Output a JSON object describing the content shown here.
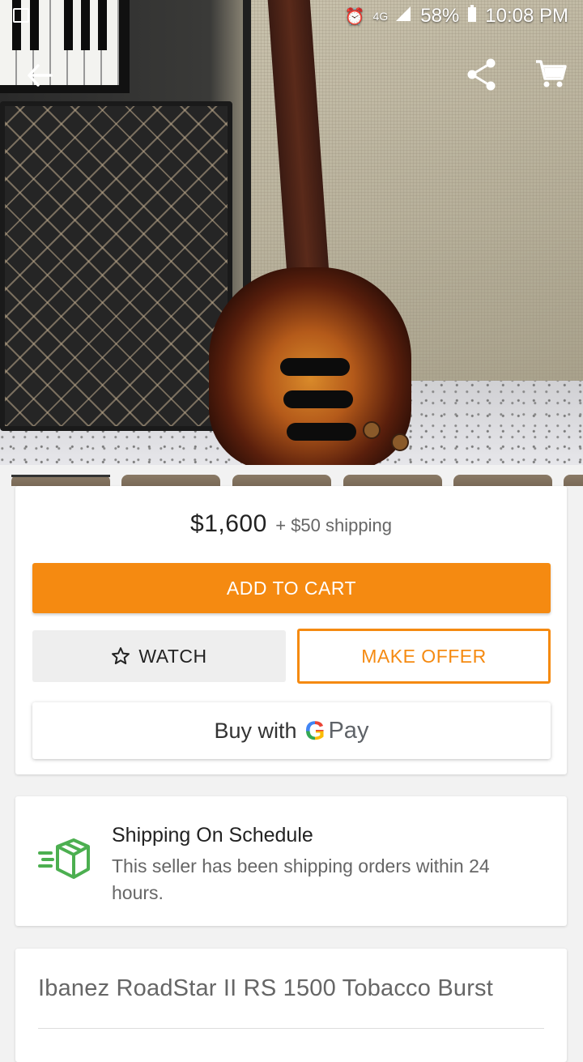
{
  "status_bar": {
    "battery": "58%",
    "time": "10:08 PM",
    "network": "4G"
  },
  "toolbar": {
    "back_icon": "arrow-left-icon",
    "share_icon": "share-icon",
    "cart_icon": "cart-icon"
  },
  "purchase": {
    "price": "$1,600",
    "shipping": "+ $50 shipping",
    "add_to_cart": "ADD TO CART",
    "watch": "WATCH",
    "make_offer": "MAKE OFFER",
    "buy_with": "Buy with",
    "gpay_g": "G",
    "gpay_pay": "Pay"
  },
  "shipping_info": {
    "title": "Shipping On Schedule",
    "text": "This seller has been shipping orders within 24 hours."
  },
  "listing": {
    "title": "Ibanez RoadStar II RS 1500 Tobacco Burst"
  },
  "colors": {
    "accent": "#f58a11",
    "ship_green": "#4caf50"
  }
}
